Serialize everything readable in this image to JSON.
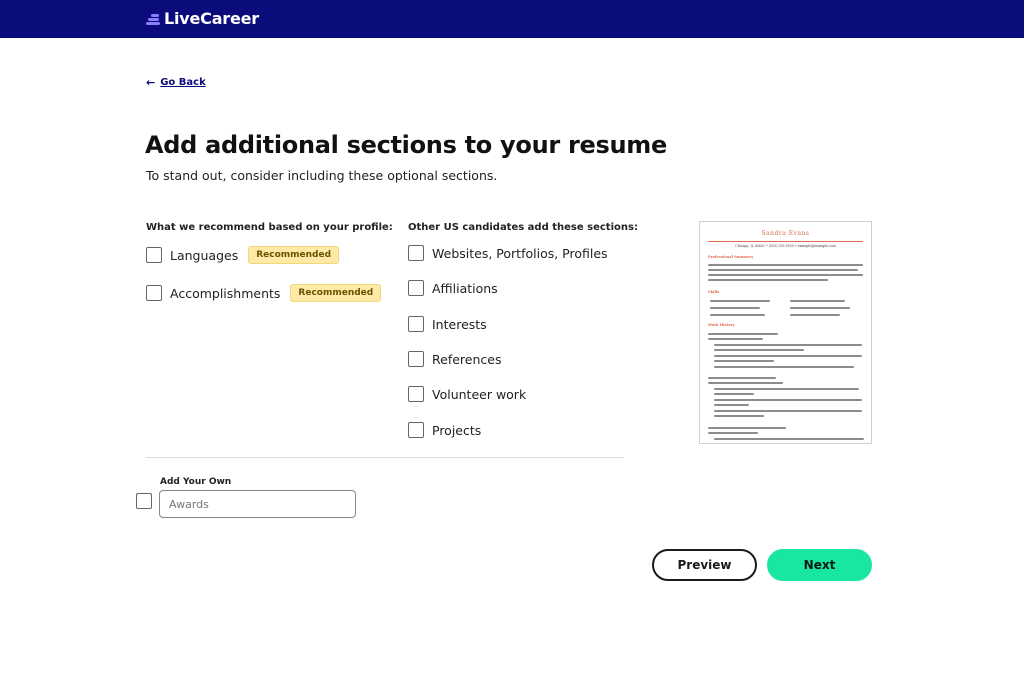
{
  "header": {
    "brand": "LiveCareer"
  },
  "nav": {
    "back_label": "Go Back"
  },
  "page": {
    "title": "Add additional sections to your resume",
    "subtitle": "To stand out, consider including these optional sections."
  },
  "recommended": {
    "heading": "What we recommend based on your profile:",
    "items": [
      {
        "label": "Languages",
        "badge": "Recommended",
        "checked": false
      },
      {
        "label": "Accomplishments",
        "badge": "Recommended",
        "checked": false
      }
    ]
  },
  "others": {
    "heading": "Other US candidates add these sections:",
    "items": [
      {
        "label": "Websites, Portfolios, Profiles",
        "checked": false
      },
      {
        "label": "Affiliations",
        "checked": false
      },
      {
        "label": "Interests",
        "checked": false
      },
      {
        "label": "References",
        "checked": false
      },
      {
        "label": "Volunteer work",
        "checked": false
      },
      {
        "label": "Projects",
        "checked": false
      }
    ]
  },
  "add_own": {
    "heading": "Add Your Own",
    "value": "",
    "placeholder": "Awards",
    "checked": false
  },
  "buttons": {
    "preview": "Preview",
    "next": "Next"
  },
  "resume_preview": {
    "name": "Sandra Evans",
    "contact": "Chicago, IL 60601 • (555) 555-5555 • example@example.com",
    "sections": [
      "Professional Summary",
      "Skills",
      "Work History"
    ]
  },
  "colors": {
    "header_bg": "#0a0c7c",
    "accent_next": "#19e6a0",
    "badge_bg": "#fdeaa6",
    "resume_accent": "#e06a4e"
  }
}
